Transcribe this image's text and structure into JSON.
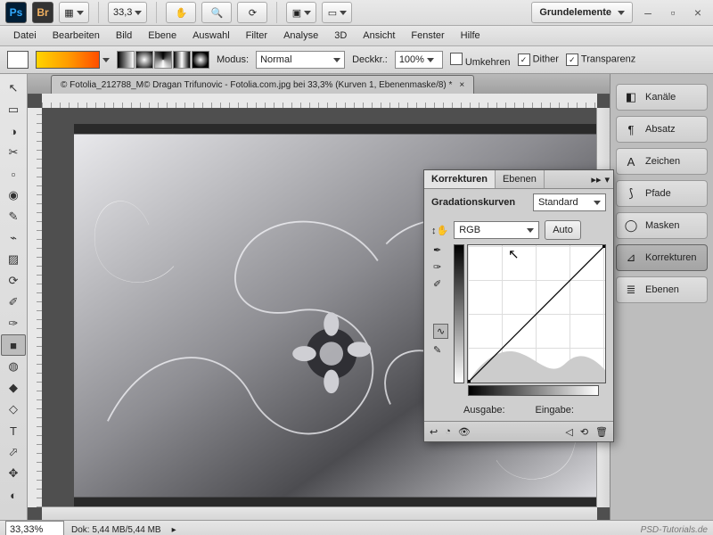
{
  "topbar": {
    "ps": "Ps",
    "br": "Br",
    "zoom": "33,3",
    "workspace": "Grundelemente"
  },
  "menu": {
    "items": [
      "Datei",
      "Bearbeiten",
      "Bild",
      "Ebene",
      "Auswahl",
      "Filter",
      "Analyse",
      "3D",
      "Ansicht",
      "Fenster",
      "Hilfe"
    ]
  },
  "optionsbar": {
    "modus_label": "Modus:",
    "modus_value": "Normal",
    "deckkr_label": "Deckkr.:",
    "deckkr_value": "100%",
    "umkehren": "Umkehren",
    "dither": "Dither",
    "transparenz": "Transparenz"
  },
  "document": {
    "tab_title": "© Fotolia_212788_M© Dragan Trifunovic - Fotolia.com.jpg bei 33,3% (Kurven 1, Ebenenmaske/8) *"
  },
  "toolbox": {
    "tools": [
      "↖",
      "▭",
      "◑",
      "✂",
      "▫",
      "◉",
      "✎",
      "⌁",
      "▨",
      "⟳",
      "✐",
      "✑",
      "■",
      "◍",
      "◆",
      "◇",
      "T",
      "⬀",
      "✥",
      "◐"
    ]
  },
  "dock": {
    "items": [
      {
        "label": "Kanäle",
        "icon": "◧"
      },
      {
        "label": "Absatz",
        "icon": "¶"
      },
      {
        "label": "Zeichen",
        "icon": "A"
      },
      {
        "label": "Pfade",
        "icon": "⟆"
      },
      {
        "label": "Masken",
        "icon": "◯"
      },
      {
        "label": "Korrekturen",
        "icon": "⊿"
      },
      {
        "label": "Ebenen",
        "icon": "≣"
      }
    ],
    "active_index": 5
  },
  "curves": {
    "tab1": "Korrekturen",
    "tab2": "Ebenen",
    "title": "Gradationskurven",
    "preset": "Standard",
    "channel": "RGB",
    "auto": "Auto",
    "ausgabe": "Ausgabe:",
    "eingabe": "Eingabe:"
  },
  "statusbar": {
    "zoom": "33,33%",
    "dok": "Dok: 5,44 MB/5,44 MB"
  },
  "watermark": "PSD-Tutorials.de"
}
